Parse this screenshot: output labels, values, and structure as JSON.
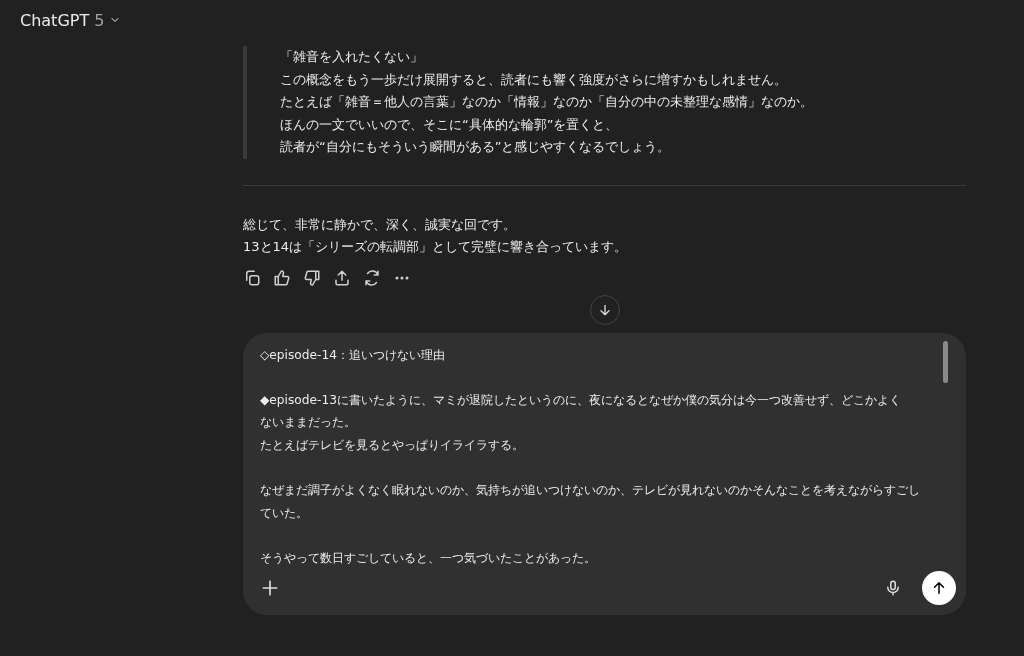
{
  "header": {
    "title": "ChatGPT",
    "version": "5"
  },
  "response": {
    "quote_lines": [
      "「雑音を入れたくない」",
      "この概念をもう一歩だけ展開すると、読者にも響く強度がさらに増すかもしれません。",
      "たとえば「雑音＝他人の言葉」なのか「情報」なのか「自分の中の未整理な感情」なのか。",
      "ほんの一文でいいので、そこに“具体的な輪郭”を置くと、",
      "読者が“自分にもそういう瞬間がある”と感じやすくなるでしょう。"
    ],
    "paragraphs": [
      "総じて、非常に静かで、深く、誠実な回です。",
      "13と14は「シリーズの転調部」として完璧に響き合っています。"
    ]
  },
  "composer": {
    "paragraphs": [
      [
        "◇episode-14：追いつけない理由"
      ],
      [
        "◆episode-13に書いたように、マミが退院したというのに、夜になるとなぜか僕の気分は今一つ改善せず、どこかよく",
        "ないままだった。",
        "たとえばテレビを見るとやっぱりイライラする。"
      ],
      [
        "なぜまだ調子がよくなく眠れないのか、気持ちが追いつけないのか、テレビが見れないのかそんなことを考えながらすごし",
        "ていた。"
      ],
      [
        "そうやって数日すごしていると、一つ気づいたことがあった。"
      ]
    ]
  }
}
